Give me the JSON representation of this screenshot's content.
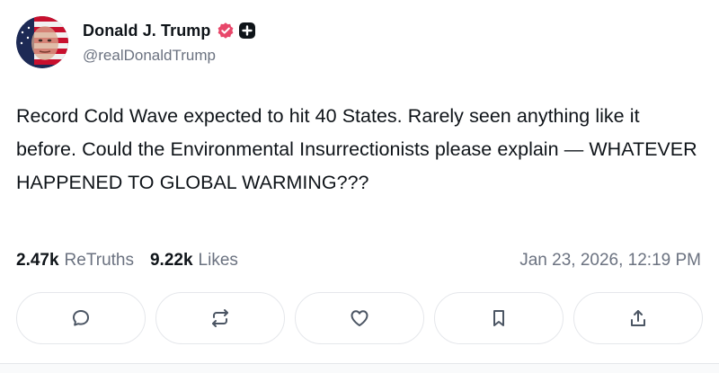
{
  "author": {
    "display_name": "Donald J. Trump",
    "handle": "@realDonaldTrump",
    "verified_badge_icon": "verified-badge-icon",
    "verified_color": "#e8476a",
    "plus_badge_icon": "plus-badge-icon"
  },
  "post": {
    "text": "Record Cold Wave expected to hit 40 States. Rarely seen anything like it before. Could the Environmental Insurrectionists please explain — WHATEVER HAPPENED TO GLOBAL WARMING???"
  },
  "stats": {
    "retruths_count": "2.47k",
    "retruths_label": "ReTruths",
    "likes_count": "9.22k",
    "likes_label": "Likes",
    "timestamp": "Jan 23, 2026, 12:19 PM"
  },
  "actions": [
    {
      "name": "reply",
      "icon": "reply-icon"
    },
    {
      "name": "retruth",
      "icon": "retruth-icon"
    },
    {
      "name": "like",
      "icon": "heart-icon"
    },
    {
      "name": "bookmark",
      "icon": "bookmark-icon"
    },
    {
      "name": "share",
      "icon": "share-icon"
    }
  ]
}
